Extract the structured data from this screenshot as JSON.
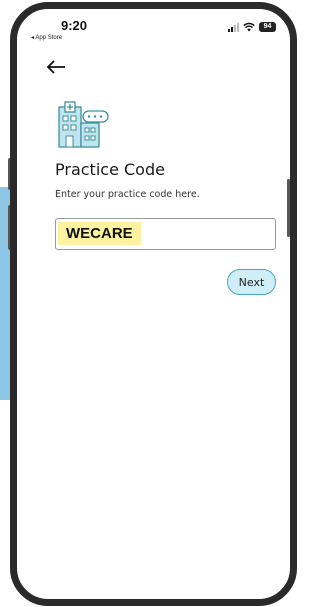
{
  "status_bar": {
    "time": "9:20",
    "back_app": "◂ App Store",
    "battery": "94"
  },
  "nav": {
    "back_icon": "arrow-left-icon"
  },
  "header": {
    "icon": "hospital-chat-icon",
    "title": "Practice Code",
    "subtitle": "Enter your practice code here."
  },
  "form": {
    "practice_code_value": "WECARE"
  },
  "actions": {
    "next_label": "Next"
  },
  "colors": {
    "input_highlight": "#fdf2a0",
    "button_fill": "#cfeef8",
    "button_border": "#4aa6c8",
    "icon_teal": "#3fa0b0"
  }
}
